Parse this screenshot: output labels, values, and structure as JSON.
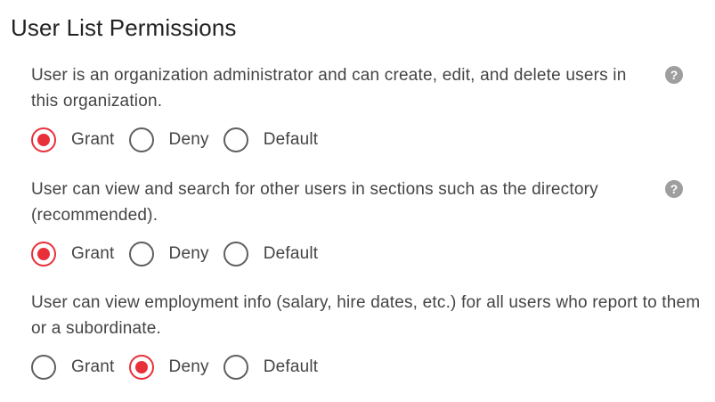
{
  "title": "User List Permissions",
  "permissions": [
    {
      "description": "User is an organization administrator and can create, edit, and delete users in this organization.",
      "has_help": true,
      "help_icon": "question-circle-icon",
      "options": [
        "Grant",
        "Deny",
        "Default"
      ],
      "selected": "Grant"
    },
    {
      "description": "User can view and search for other users in sections such as the directory (recommended).",
      "has_help": true,
      "help_icon": "question-circle-icon",
      "options": [
        "Grant",
        "Deny",
        "Default"
      ],
      "selected": "Grant"
    },
    {
      "description": "User can view employment info (salary, hire dates, etc.) for all users who report to them or a subordinate.",
      "has_help": false,
      "options": [
        "Grant",
        "Deny",
        "Default"
      ],
      "selected": "Deny"
    }
  ],
  "colors": {
    "accent": "#e8303b",
    "radio_border": "#5f5f5f",
    "help_icon": "#9e9e9e",
    "text": "#444444"
  }
}
